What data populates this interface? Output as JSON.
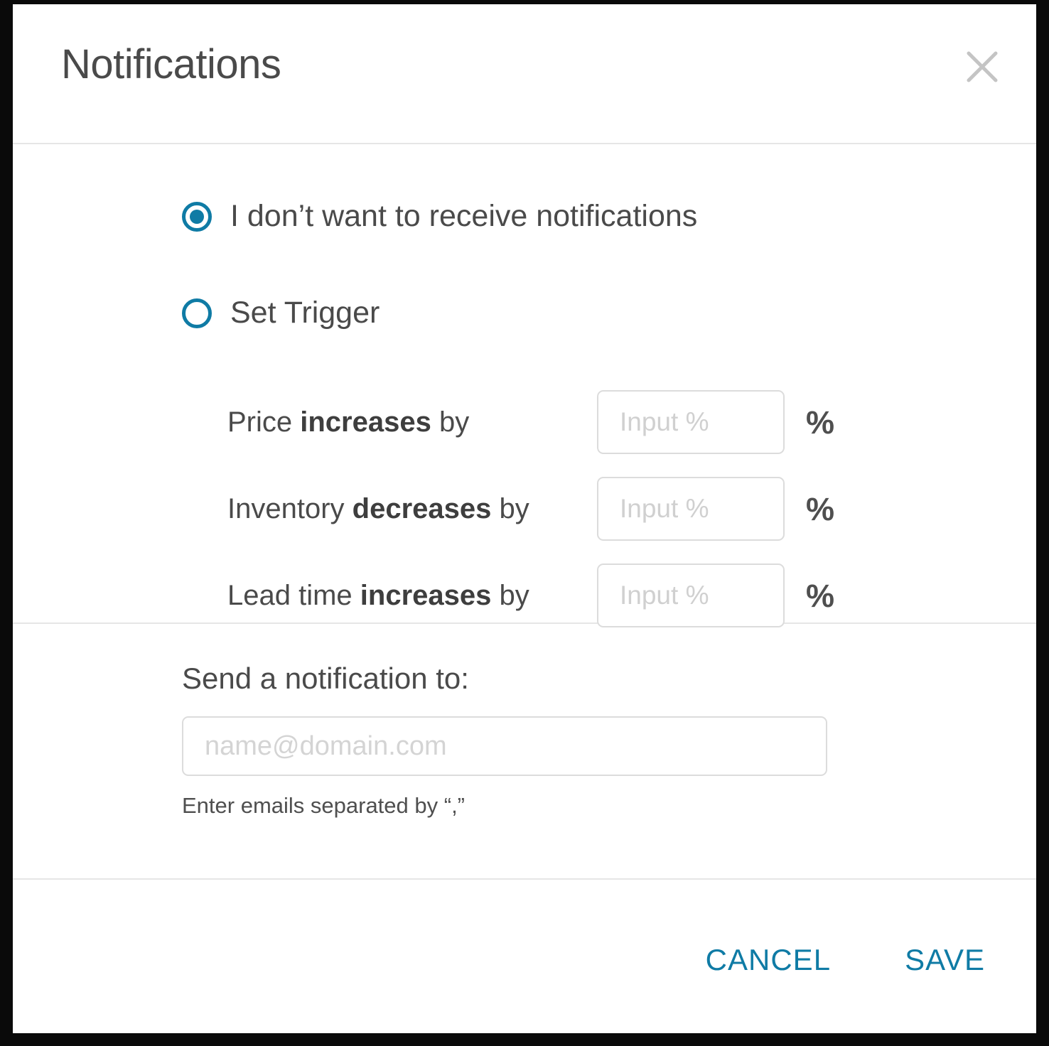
{
  "dialog": {
    "title": "Notifications",
    "close_icon": "close-icon"
  },
  "options": [
    {
      "id": "no-notifications",
      "label": "I don’t want to receive notifications",
      "selected": true
    },
    {
      "id": "set-trigger",
      "label": "Set Trigger",
      "selected": false
    }
  ],
  "triggers": [
    {
      "id": "price-increases",
      "prefix": "Price ",
      "emphasis": "increases",
      "suffix": " by",
      "value": "",
      "placeholder": "Input %",
      "unit": "%"
    },
    {
      "id": "inventory-decreases",
      "prefix": "Inventory ",
      "emphasis": "decreases",
      "suffix": " by",
      "value": "",
      "placeholder": "Input %",
      "unit": "%"
    },
    {
      "id": "lead-time-increases",
      "prefix": "Lead time ",
      "emphasis": "increases",
      "suffix": " by",
      "value": "",
      "placeholder": "Input %",
      "unit": "%"
    }
  ],
  "email": {
    "label": "Send a notification to:",
    "value": "",
    "placeholder": "name@domain.com",
    "hint": "Enter emails separated by “,”"
  },
  "footer": {
    "cancel_label": "CANCEL",
    "save_label": "SAVE"
  },
  "colors": {
    "accent": "#0f7ba5",
    "text": "#4a4a4a",
    "border": "#dcdcdc",
    "divider": "#e6e6e6",
    "placeholder": "#d4d4d4",
    "close_icon": "#c4c4c4"
  }
}
